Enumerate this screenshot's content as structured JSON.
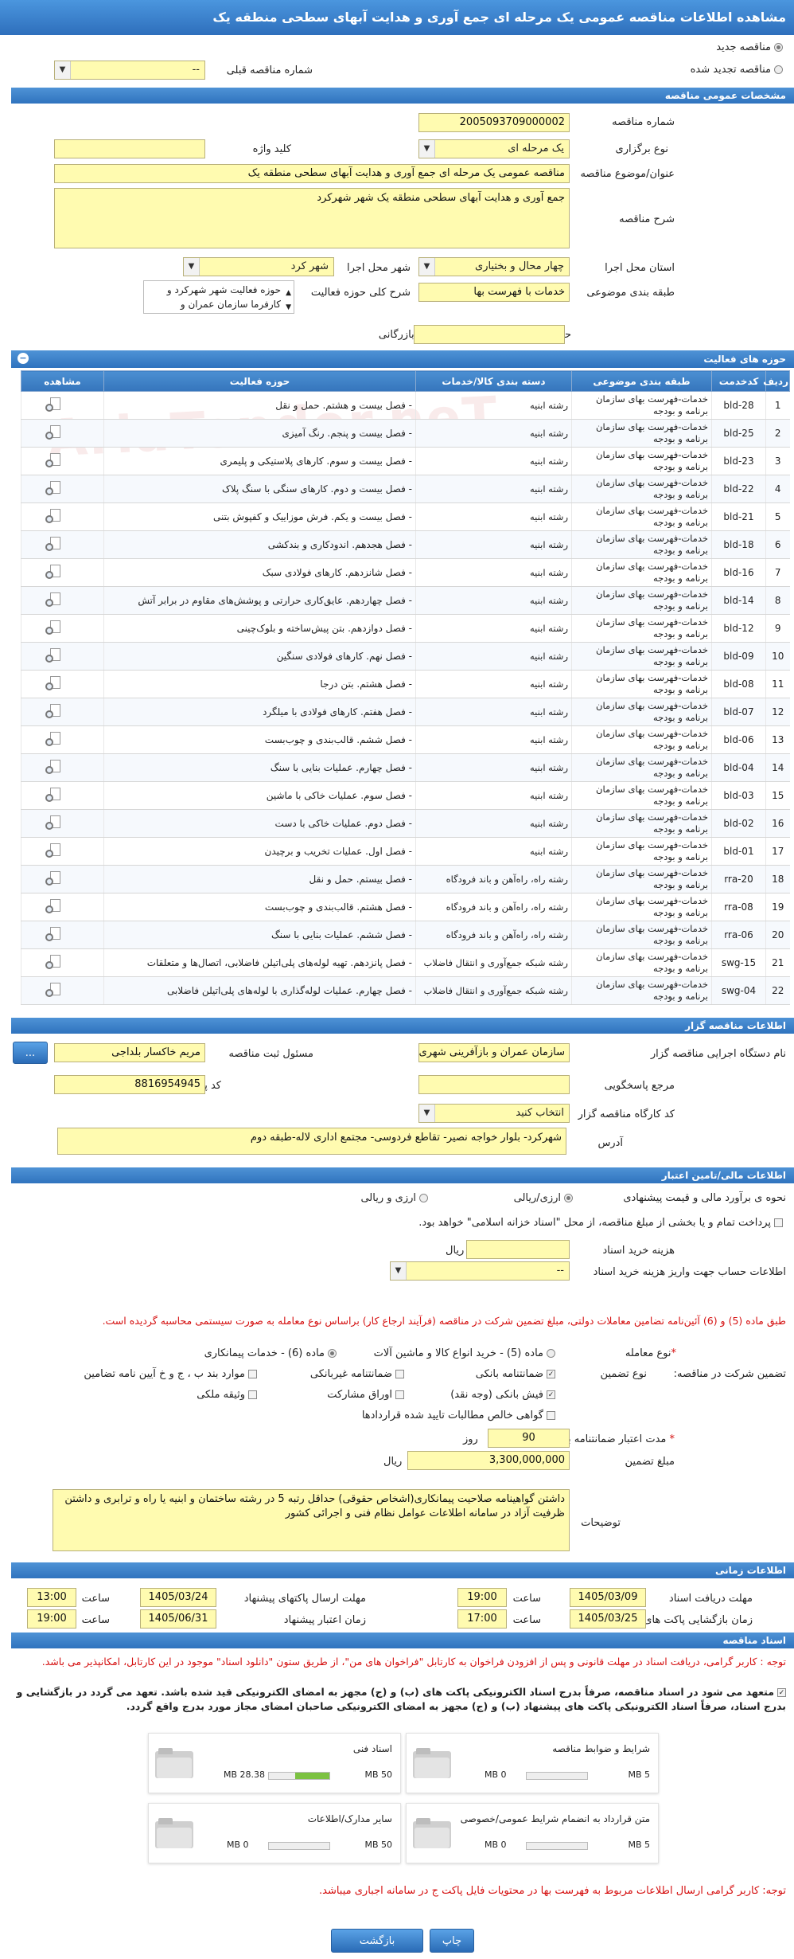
{
  "title": "مشاهده اطلاعات مناقصه عمومی یک مرحله ای جمع آوری و هدایت آبهای سطحی منطقه یک",
  "top": {
    "radio_new": "مناقصه جدید",
    "radio_renewal": "مناقصه تجدید شده",
    "prev_number_label": "شماره مناقصه قبلی",
    "prev_number_value": "--"
  },
  "general": {
    "header": "مشخصات عمومی مناقصه",
    "number_label": "شماره مناقصه",
    "number_value": "2005093709000002",
    "type_label": "نوع برگزاری",
    "type_value": "یک مرحله ای",
    "keyword_label": "کلید واژه",
    "keyword_value": "",
    "subject_label": "عنوان/موضوع مناقصه",
    "subject_value": "مناقصه عمومی یک مرحله ای جمع آوری و هدایت آبهای سطحی منطقه یک",
    "description_label": "شرح مناقصه",
    "description_value": "جمع آوری و هدایت آبهای سطحی منطقه یک شهر شهرکرد",
    "province_label": "استان محل اجرا",
    "province_value": "چهار محال و بختیاری",
    "city_label": "شهر محل اجرا",
    "city_value": "شهر کرد",
    "category_label": "طبقه بندی موضوعی",
    "category_value": "خدمات با فهرست بها",
    "scope_label": "شرح کلی حوزه فعالیت",
    "scope_value": "حوزه فعالیت شهر شهرکرد و کارفرما سازمان عمران و",
    "min_score_label": "حداقل امتیاز قابل قبول ارزیابی فنی/بازرگانی",
    "min_score_value": ""
  },
  "activities": {
    "header": "حوزه های فعالیت",
    "columns": [
      "ردیف",
      "کدخدمت",
      "طبقه بندی موضوعی",
      "دسته بندی کالا/خدمات",
      "حوزه فعالیت",
      "مشاهده"
    ],
    "rows": [
      [
        "1",
        "bld-28",
        "خدمات-فهرست بهای سازمان برنامه و بودجه",
        "رشته ابنیه",
        "- فصل بیست و هشتم. حمل و نقل"
      ],
      [
        "2",
        "bld-25",
        "خدمات-فهرست بهای سازمان برنامه و بودجه",
        "رشته ابنیه",
        "- فصل بیست و پنجم. رنگ آمیزی"
      ],
      [
        "3",
        "bld-23",
        "خدمات-فهرست بهای سازمان برنامه و بودجه",
        "رشته ابنیه",
        "- فصل بیست و سوم. کارهای پلاستیکی و پلیمری"
      ],
      [
        "4",
        "bld-22",
        "خدمات-فهرست بهای سازمان برنامه و بودجه",
        "رشته ابنیه",
        "- فصل بیست و دوم. کارهای سنگی با سنگ پلاک"
      ],
      [
        "5",
        "bld-21",
        "خدمات-فهرست بهای سازمان برنامه و بودجه",
        "رشته ابنیه",
        "- فصل بیست و یکم. فرش موزاییک و کفپوش بتنی"
      ],
      [
        "6",
        "bld-18",
        "خدمات-فهرست بهای سازمان برنامه و بودجه",
        "رشته ابنیه",
        "- فصل هجدهم. اندودکاری و بندکشی"
      ],
      [
        "7",
        "bld-16",
        "خدمات-فهرست بهای سازمان برنامه و بودجه",
        "رشته ابنیه",
        "- فصل شانزدهم. کارهای فولادی سبک"
      ],
      [
        "8",
        "bld-14",
        "خدمات-فهرست بهای سازمان برنامه و بودجه",
        "رشته ابنیه",
        "- فصل چهاردهم. عایق‌کاری حرارتی و پوشش‌های مقاوم در برابر آتش"
      ],
      [
        "9",
        "bld-12",
        "خدمات-فهرست بهای سازمان برنامه و بودجه",
        "رشته ابنیه",
        "- فصل دوازدهم. بتن پیش‌ساخته و بلوک‌چینی"
      ],
      [
        "10",
        "bld-09",
        "خدمات-فهرست بهای سازمان برنامه و بودجه",
        "رشته ابنیه",
        "- فصل نهم. کارهای فولادی سنگین"
      ],
      [
        "11",
        "bld-08",
        "خدمات-فهرست بهای سازمان برنامه و بودجه",
        "رشته ابنیه",
        "- فصل هشتم. بتن درجا"
      ],
      [
        "12",
        "bld-07",
        "خدمات-فهرست بهای سازمان برنامه و بودجه",
        "رشته ابنیه",
        "- فصل هفتم. کارهای فولادی با میلگرد"
      ],
      [
        "13",
        "bld-06",
        "خدمات-فهرست بهای سازمان برنامه و بودجه",
        "رشته ابنیه",
        "- فصل ششم. قالب‌بندی و چوب‌بست"
      ],
      [
        "14",
        "bld-04",
        "خدمات-فهرست بهای سازمان برنامه و بودجه",
        "رشته ابنیه",
        "- فصل چهارم. عملیات بنایی با سنگ"
      ],
      [
        "15",
        "bld-03",
        "خدمات-فهرست بهای سازمان برنامه و بودجه",
        "رشته ابنیه",
        "- فصل سوم. عملیات خاکی با ماشین"
      ],
      [
        "16",
        "bld-02",
        "خدمات-فهرست بهای سازمان برنامه و بودجه",
        "رشته ابنیه",
        "- فصل دوم. عملیات خاکی با دست"
      ],
      [
        "17",
        "bld-01",
        "خدمات-فهرست بهای سازمان برنامه و بودجه",
        "رشته ابنیه",
        "- فصل اول. عملیات تخریب و برچیدن"
      ],
      [
        "18",
        "rra-20",
        "خدمات-فهرست بهای سازمان برنامه و بودجه",
        "رشته راه، راه‌آهن و باند فرودگاه",
        "- فصل بیستم. حمل و نقل"
      ],
      [
        "19",
        "rra-08",
        "خدمات-فهرست بهای سازمان برنامه و بودجه",
        "رشته راه، راه‌آهن و باند فرودگاه",
        "- فصل هشتم. قالب‌بندی و چوب‌بست"
      ],
      [
        "20",
        "rra-06",
        "خدمات-فهرست بهای سازمان برنامه و بودجه",
        "رشته راه، راه‌آهن و باند فرودگاه",
        "- فصل ششم. عملیات بنایی با سنگ"
      ],
      [
        "21",
        "swg-15",
        "خدمات-فهرست بهای سازمان برنامه و بودجه",
        "رشته شبکه جمع‌آوری و انتقال فاضلاب",
        "- فصل پانزدهم. تهیه لوله‌های پلی‌اتیلن فاضلابی، اتصال‌ها و متعلقات"
      ],
      [
        "22",
        "swg-04",
        "خدمات-فهرست بهای سازمان برنامه و بودجه",
        "رشته شبکه جمع‌آوری و انتقال فاضلاب",
        "- فصل چهارم. عملیات لوله‌گذاری با لوله‌های پلی‌اتیلن فاضلابی"
      ]
    ]
  },
  "org": {
    "header": "اطلاعات مناقصه گزار",
    "exec_label": "نام دستگاه اجرایی مناقصه گزار",
    "exec_value": "سازمان عمران و بازآفرینی شهری",
    "responsible_label": "مسئول ثبت مناقصه",
    "responsible_value": "مریم خاکسار بلداجی",
    "browse_label": "...",
    "ref_label": "مرجع پاسخگویی",
    "ref_value": "",
    "postal_label": "کد پستی",
    "postal_value": "8816954945",
    "workshop_label": "کد کارگاه مناقصه گزار",
    "workshop_value": "انتخاب کنید",
    "address_label": "آدرس",
    "address_value": "شهرکرد- بلوار خواجه نصیر- تقاطع فردوسی- مجتمع اداری لاله-طبقه دوم"
  },
  "finance": {
    "header": "اطلاعات مالی/تامین اعتبار",
    "estimate_label": "نحوه ی برآورد مالی و قیمت پیشنهادی",
    "opt_rial": "ارزی/ریالی",
    "opt_both": "ارزی و ریالی",
    "treasury_text": "پرداخت تمام و یا بخشی از مبلغ مناقصه، از محل \"اسناد خزانه اسلامی\" خواهد بود.",
    "doc_cost_label": "هزینه خرید اسناد",
    "doc_cost_unit": "ریال",
    "doc_cost_value": "",
    "account_label": "اطلاعات حساب جهت واریز هزینه خرید اسناد",
    "account_value": "--"
  },
  "guarantee": {
    "note": "طبق ماده (5) و (6) آئین‌نامه تضامین معاملات دولتی، مبلغ تضمین شرکت در مناقصه (فرآیند ارجاع کار) براساس نوع معامله به صورت سیستمی محاسبه گردیده است.",
    "deal_type_label": "نوع معامله",
    "deal_opt1": "ماده (5) - خرید انواع کالا و ماشین آلات",
    "deal_opt2": "ماده (6) - خدمات پیمانکاری",
    "type_label": "تضمین شرکت در مناقصه:",
    "kind_label": "نوع تضمین",
    "options": [
      "ضمانتنامه بانکی",
      "ضمانتنامه غیربانکی",
      "موارد بند ب ، ج و خ آیین نامه تضامین",
      "فیش بانکی (وجه نقد)",
      "اوراق مشارکت",
      "وثیقه ملکی",
      "گواهی خالص مطالبات تایید شده قراردادها"
    ],
    "validity_label": "مدت اعتبار ضمانتنامه بانکی",
    "validity_value": "90",
    "validity_unit": "روز",
    "amount_label": "مبلغ تضمین",
    "amount_value": "3,300,000,000",
    "amount_unit": "ریال",
    "notes_label": "توضیحات",
    "notes_value": "داشتن گواهینامه صلاحیت پیمانکاری(اشخاص حقوقی) حداقل رتبه 5 در رشته ساختمان و ابنیه یا راه و ترابری و داشتن ظرفیت آزاد در سامانه اطلاعات عوامل نظام فنی و اجرائی کشور"
  },
  "timing": {
    "header": "اطلاعات زمانی",
    "receive_label": "مهلت دریافت اسناد",
    "receive_date": "1405/03/09",
    "receive_time": "19:00",
    "send_label": "مهلت ارسال پاکتهای پیشنهاد",
    "send_date": "1405/03/24",
    "send_time": "13:00",
    "open_label": "زمان بازگشایی پاکت های",
    "open_date": "1405/03/25",
    "open_time": "17:00",
    "valid_label": "زمان اعتبار پیشنهاد",
    "valid_date": "1405/06/31",
    "valid_time": "19:00",
    "time_label": "ساعت"
  },
  "docs": {
    "header": "اسناد مناقصه",
    "notice1": "توجه : کاربر گرامی، دریافت اسناد در مهلت قانونی و پس از افزودن فراخوان به کارتابل \"فراخوان های من\"، از طریق ستون \"دانلود اسناد\" موجود در این کارتابل، امکانپذیر می باشد.",
    "commit": "متعهد می شود در اسناد مناقصه، صرفاً بدرج اسناد الکترونیکی پاکت های (ب) و (ج) مجهز به امضای الکترونیکی قید شده باشد. تعهد می گردد در بازگشایی و بدرج اسناد، صرفاً اسناد الکترونیکی پاکت های پیشنهاد (ب) و (ج) مجهز به امضای الکترونیکی صاحبان امضای مجاز مورد بدرج واقع گردد.",
    "cards": [
      {
        "name": "شرایط و ضوابط مناقصه",
        "used": "0 MB",
        "max": "5 MB",
        "fill_fraction": 0
      },
      {
        "name": "اسناد فنی",
        "used": "28.38 MB",
        "max": "50 MB",
        "fill_fraction": 0.57
      },
      {
        "name": "متن قرارداد به انضمام شرایط عمومی/خصوصی",
        "used": "0 MB",
        "max": "5 MB",
        "fill_fraction": 0
      },
      {
        "name": "سایر مدارک/اطلاعات",
        "used": "0 MB",
        "max": "50 MB",
        "fill_fraction": 0
      }
    ],
    "notice2": "توجه: کاربر گرامی ارسال اطلاعات مربوط به فهرست بها در محتویات فایل پاکت ج در سامانه اجباری میباشد."
  },
  "footer": {
    "print": "چاپ",
    "back": "بازگشت"
  },
  "watermark": "AriaTender.neT"
}
